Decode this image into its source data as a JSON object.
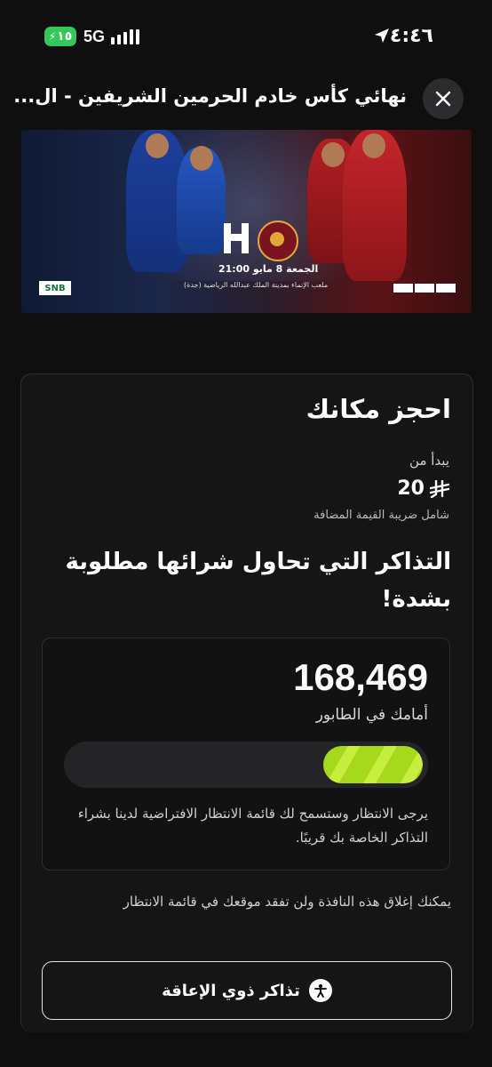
{
  "status_bar": {
    "battery": "١٥",
    "network": "5G",
    "time": "٤:٤٦"
  },
  "header": {
    "title": "نهائي كأس خادم الحرمين الشريفين - ال..."
  },
  "banner": {
    "date_time": "الجمعة 8 مايو 21:00",
    "venue": "ملعب الإنماء بمدينة الملك عبدالله الرياضية (جدة)",
    "sponsor_left": "SNB"
  },
  "card": {
    "title": "احجز مكانك",
    "starts_from": "يبدأ من",
    "price": "20",
    "currency_icon": "riyal-symbol",
    "vat_note": "شامل ضريبة القيمة المضافة",
    "demand_text": "التذاكر التي تحاول شرائها مطلوبة بشدة!",
    "queue": {
      "ahead_count": "168,469",
      "ahead_label": "أمامك في الطابور",
      "progress_percent": 25,
      "message": "يرجى الانتظار وستسمح لك قائمة الانتظار الافتراضية لدينا بشراء التذاكر الخاصة بك قريبًا."
    },
    "close_note": "يمكنك إغلاق هذه النافذة ولن تفقد موقعك في قائمة الانتظار",
    "accessibility_button": "تذاكر ذوي الإعاقة"
  },
  "colors": {
    "background": "#0f0f10",
    "progress_fill": "#b8e52a",
    "battery": "#34c759"
  }
}
